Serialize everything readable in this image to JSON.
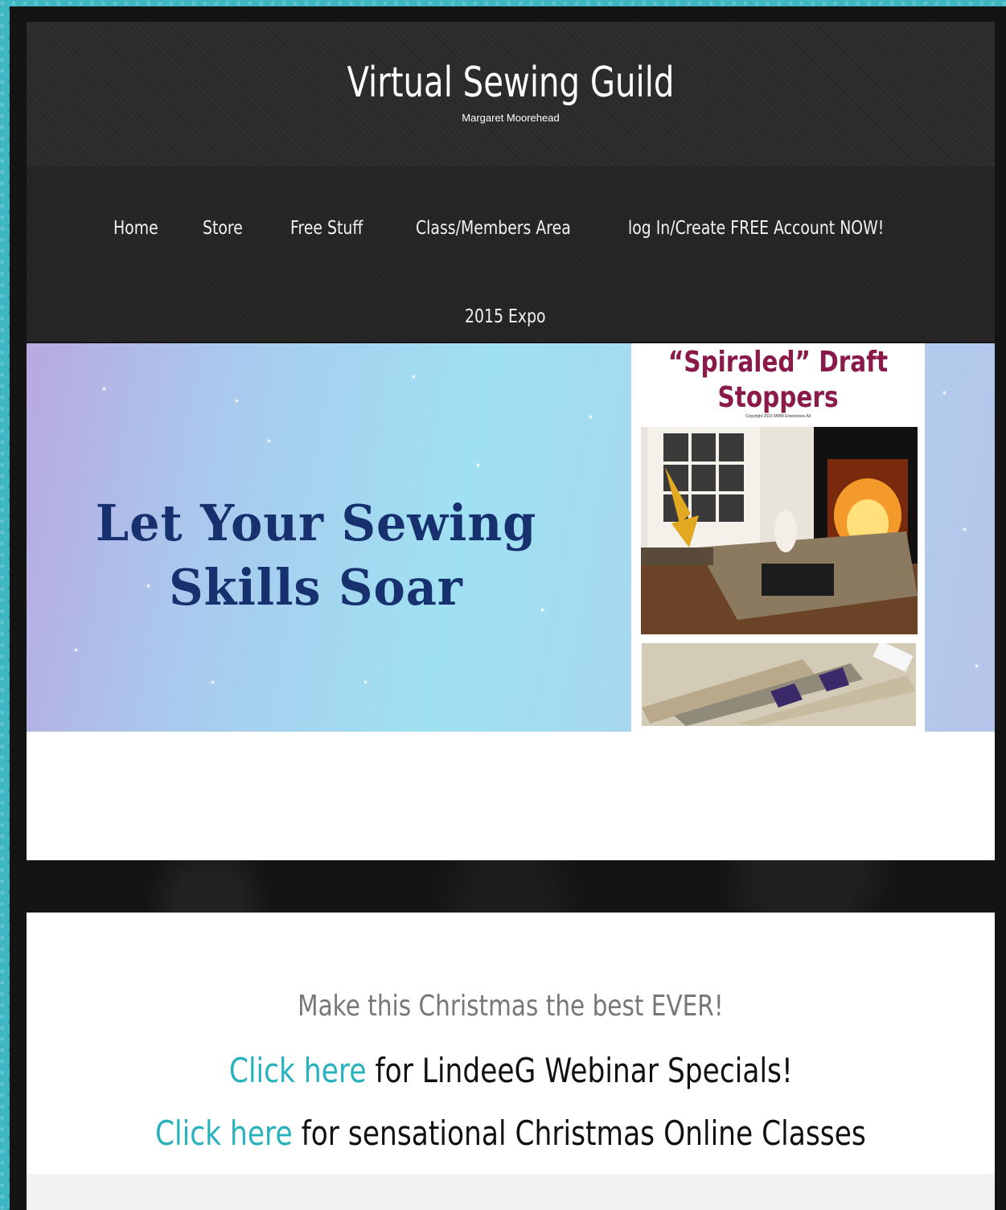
{
  "header": {
    "site_title": "Virtual Sewing Guild",
    "tagline": "Margaret Moorehead"
  },
  "nav": {
    "items": [
      {
        "label": "Home"
      },
      {
        "label": "Store"
      },
      {
        "label": "Free Stuff"
      },
      {
        "label": "Class/Members Area"
      },
      {
        "label": "log In/Create FREE Account NOW!"
      },
      {
        "label": "2015 Expo"
      }
    ]
  },
  "hero": {
    "heading_line1": "Let Your Sewing",
    "heading_line2": "Skills Soar",
    "product_title_line1": "“Spiraled” Draft",
    "product_title_line2": "Stoppers",
    "product_copyright": "Copyright 2015 MMM Enterprises All"
  },
  "content": {
    "promo_line": "Make this Christmas the best EVER!",
    "link1_text": "Click here",
    "link1_suffix": " for LindeeG Webinar Specials!",
    "link2_text": "Click here",
    "link2_suffix": " for sensational Christmas Online Classes"
  },
  "colors": {
    "link": "#27b2bd",
    "header_bg": "#2a2a2a",
    "hero_heading": "#17306e",
    "product_title": "#8a1a4a",
    "page_border": "#3fb7c3"
  }
}
